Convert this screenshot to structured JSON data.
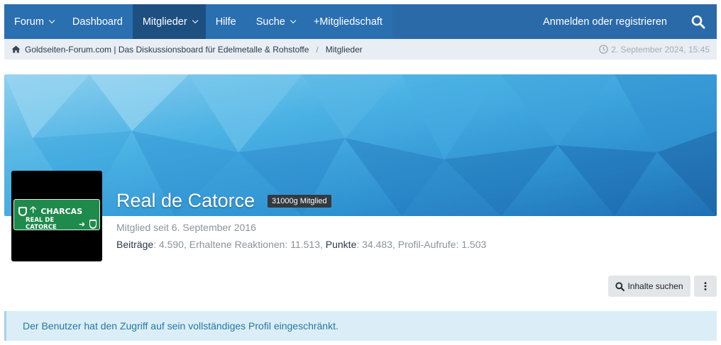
{
  "nav": {
    "items": [
      {
        "label": "Forum",
        "dropdown": true
      },
      {
        "label": "Dashboard",
        "dropdown": false
      },
      {
        "label": "Mitglieder",
        "dropdown": true
      },
      {
        "label": "Hilfe",
        "dropdown": false
      },
      {
        "label": "Suche",
        "dropdown": true
      },
      {
        "label": "+Mitgliedschaft",
        "dropdown": false
      }
    ],
    "active": "Mitglieder",
    "login_label": "Anmelden oder registrieren",
    "search_icon": "search-icon"
  },
  "breadcrumb": {
    "home_icon": "home-icon",
    "items": [
      "Goldseiten-Forum.com | Das Diskussionsboard für Edelmetalle & Rohstoffe",
      "Mitglieder"
    ],
    "separator": "/",
    "datetime": "2. September 2024, 15:45",
    "clock_icon": "clock-icon"
  },
  "profile": {
    "username": "Real de Catorce",
    "rank_badge": "31000g Mitglied",
    "member_since": "Mitglied seit 6. September 2016",
    "avatar_sign": {
      "line1": "CHARCAS",
      "line2": "REAL DE CATORCE",
      "route1": "63",
      "route2": "86"
    },
    "stats": {
      "posts_label": "Beiträge",
      "posts_value": "4.590",
      "reactions_label": "Erhaltene Reaktionen",
      "reactions_value": "11.513",
      "points_label": "Punkte",
      "points_value": "34.483",
      "views_label": "Profil-Aufrufe",
      "views_value": "1.503"
    }
  },
  "actions": {
    "find_content_label": "Inhalte suchen",
    "find_icon": "search-icon",
    "more_icon": "vertical-dots-icon"
  },
  "notice": {
    "text": "Der Benutzer hat den Zugriff auf sein vollständiges Profil eingeschränkt."
  },
  "colors": {
    "navbar": "#2b6aa9",
    "nav_active": "#1d4f80",
    "breadcrumb_bg": "#e8eef4",
    "banner_base": "#3aa0d8",
    "notice_bg": "#dbeef7",
    "notice_text": "#2577a3",
    "badge_bg": "#33393f"
  }
}
